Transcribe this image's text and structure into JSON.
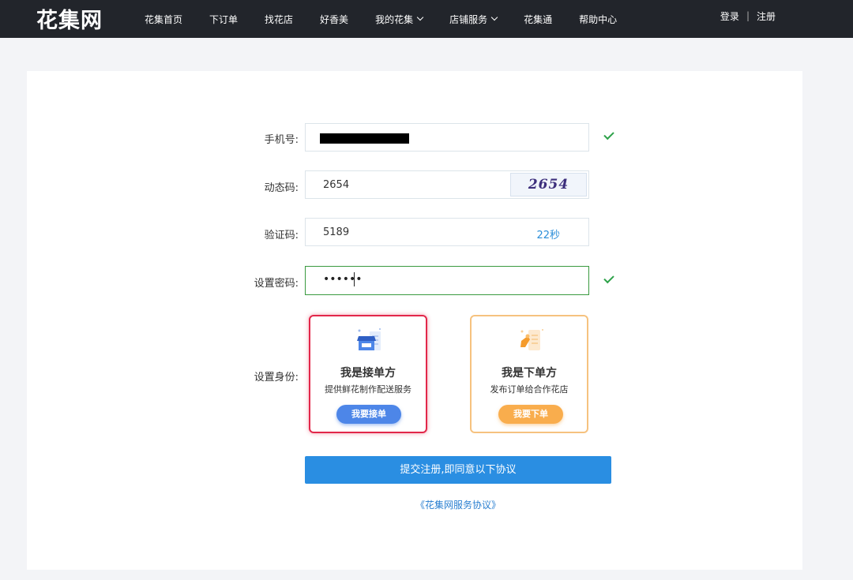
{
  "header": {
    "logo": "花集网",
    "nav": [
      {
        "label": "花集首页"
      },
      {
        "label": "下订单"
      },
      {
        "label": "找花店"
      },
      {
        "label": "好香美"
      },
      {
        "label": "我的花集"
      },
      {
        "label": "店铺服务"
      },
      {
        "label": "花集通"
      },
      {
        "label": "帮助中心"
      }
    ],
    "login": "登录",
    "separator": "|",
    "register": "注册"
  },
  "form": {
    "phone": {
      "label": "手机号:",
      "value_redacted": true,
      "status_icon": "check-icon"
    },
    "dynamic_code": {
      "label": "动态码:",
      "value": "2654",
      "captcha_text": "2654"
    },
    "verify_code": {
      "label": "验证码:",
      "value": "5189",
      "countdown": "22秒"
    },
    "password": {
      "label": "设置密码:",
      "value": "••••••",
      "status_icon": "check-icon"
    },
    "identity": {
      "label": "设置身份:",
      "options": [
        {
          "title": "我是接单方",
          "desc": "提供鲜花制作配送服务",
          "button": "我要接单",
          "icon": "shop-icon",
          "selected": true
        },
        {
          "title": "我是下单方",
          "desc": "发布订单给合作花店",
          "button": "我要下单",
          "icon": "phone-order-icon",
          "selected": false
        }
      ]
    },
    "submit": "提交注册,即同意以下协议",
    "agreement_link": "《花集网服务协议》"
  },
  "colors": {
    "topbar": "#22252b",
    "accent_blue": "#2a8ee2",
    "success_green": "#2ea24a",
    "selected_red": "#e2274a",
    "orange": "#f9ad4d"
  }
}
